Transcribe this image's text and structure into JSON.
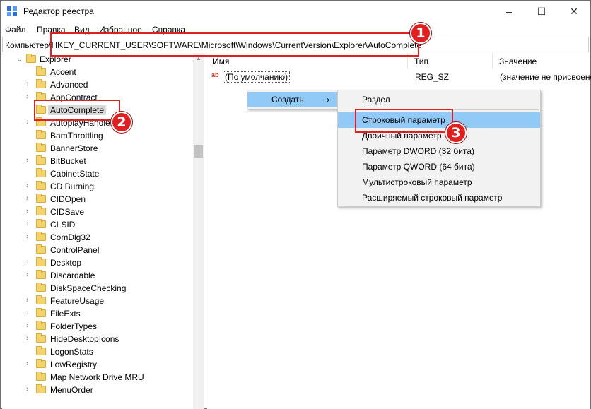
{
  "window": {
    "title": "Редактор реестра",
    "minimize": "–",
    "maximize": "☐",
    "close": "✕"
  },
  "menu": [
    "Файл",
    "Правка",
    "Вид",
    "Избранное",
    "Справка"
  ],
  "address": "Компьютер\\HKEY_CURRENT_USER\\SOFTWARE\\Microsoft\\Windows\\CurrentVersion\\Explorer\\AutoComplete",
  "tree": {
    "parent": "Explorer",
    "items": [
      {
        "label": "Accent",
        "expandable": false
      },
      {
        "label": "Advanced",
        "expandable": true
      },
      {
        "label": "AppContract",
        "expandable": true
      },
      {
        "label": "AutoComplete",
        "expandable": false,
        "selected": true
      },
      {
        "label": "AutoplayHandlers",
        "expandable": true
      },
      {
        "label": "BamThrottling",
        "expandable": false
      },
      {
        "label": "BannerStore",
        "expandable": false
      },
      {
        "label": "BitBucket",
        "expandable": true
      },
      {
        "label": "CabinetState",
        "expandable": false
      },
      {
        "label": "CD Burning",
        "expandable": true
      },
      {
        "label": "CIDOpen",
        "expandable": true
      },
      {
        "label": "CIDSave",
        "expandable": true
      },
      {
        "label": "CLSID",
        "expandable": true
      },
      {
        "label": "ComDlg32",
        "expandable": true
      },
      {
        "label": "ControlPanel",
        "expandable": false
      },
      {
        "label": "Desktop",
        "expandable": true
      },
      {
        "label": "Discardable",
        "expandable": true
      },
      {
        "label": "DiskSpaceChecking",
        "expandable": false
      },
      {
        "label": "FeatureUsage",
        "expandable": true
      },
      {
        "label": "FileExts",
        "expandable": true
      },
      {
        "label": "FolderTypes",
        "expandable": true
      },
      {
        "label": "HideDesktopIcons",
        "expandable": true
      },
      {
        "label": "LogonStats",
        "expandable": false
      },
      {
        "label": "LowRegistry",
        "expandable": true
      },
      {
        "label": "Map Network Drive MRU",
        "expandable": false
      },
      {
        "label": "MenuOrder",
        "expandable": true
      }
    ]
  },
  "columns": {
    "name": "Имя",
    "type": "Тип",
    "value": "Значение"
  },
  "values": [
    {
      "name": "(По умолчанию)",
      "type": "REG_SZ",
      "data": "(значение не присвоено)"
    }
  ],
  "context_menu": {
    "create": "Создать",
    "arrow": "›"
  },
  "submenu": [
    "Раздел",
    "Строковый параметр",
    "Двоичный параметр",
    "Параметр DWORD (32 бита)",
    "Параметр QWORD (64 бита)",
    "Мультистроковый параметр",
    "Расширяемый строковый параметр"
  ],
  "highlighted_submenu_index": 1,
  "badges": [
    "1",
    "2",
    "3"
  ],
  "colors": {
    "highlight": "#91c9f7",
    "annotation": "#e02020",
    "folder": "#f4d36b"
  }
}
